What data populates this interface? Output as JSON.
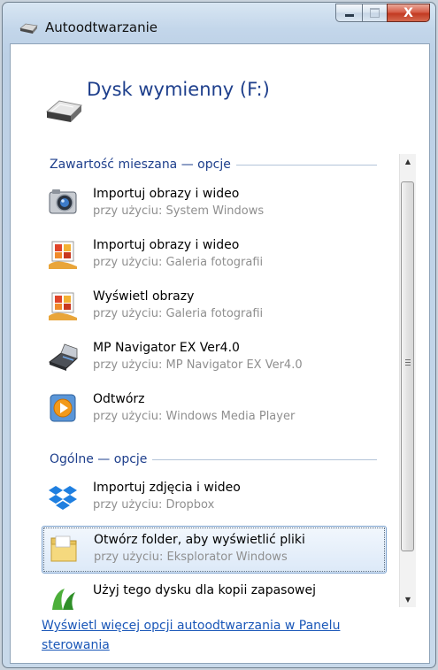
{
  "window": {
    "title": "Autoodtwarzanie",
    "close_label": "X"
  },
  "device": {
    "title": "Dysk wymienny (F:)"
  },
  "groups": [
    {
      "label": "Zawartość mieszana — opcje"
    },
    {
      "label": "Ogólne — opcje"
    }
  ],
  "items": [
    {
      "title": "Importuj obrazy i wideo",
      "subtitle": "przy użyciu: System Windows",
      "icon": "camera-icon"
    },
    {
      "title": "Importuj obrazy i wideo",
      "subtitle": "przy użyciu: Galeria fotografii",
      "icon": "photo-gallery-icon"
    },
    {
      "title": "Wyświetl obrazy",
      "subtitle": "przy użyciu: Galeria fotografii",
      "icon": "photo-gallery-icon"
    },
    {
      "title": "MP Navigator EX Ver4.0",
      "subtitle": "przy użyciu: MP Navigator EX Ver4.0",
      "icon": "scanner-icon"
    },
    {
      "title": "Odtwórz",
      "subtitle": "przy użyciu: Windows Media Player",
      "icon": "media-player-icon"
    },
    {
      "title": "Importuj zdjęcia i wideo",
      "subtitle": "przy użyciu: Dropbox",
      "icon": "dropbox-icon"
    },
    {
      "title": "Otwórz folder, aby wyświetlić pliki",
      "subtitle": "przy użyciu: Eksplorator Windows",
      "icon": "folder-icon",
      "selected": true
    },
    {
      "title": "Użyj tego dysku dla kopii zapasowej",
      "subtitle": "",
      "icon": "backup-icon"
    }
  ],
  "footer": {
    "link": "Wyświetl więcej opcji autoodtwarzania w Panelu sterowania"
  },
  "colors": {
    "accent_text": "#1e3f8c",
    "link": "#1a57b8",
    "subtitle": "#8f8f8f",
    "close_button": "#c23a22"
  }
}
